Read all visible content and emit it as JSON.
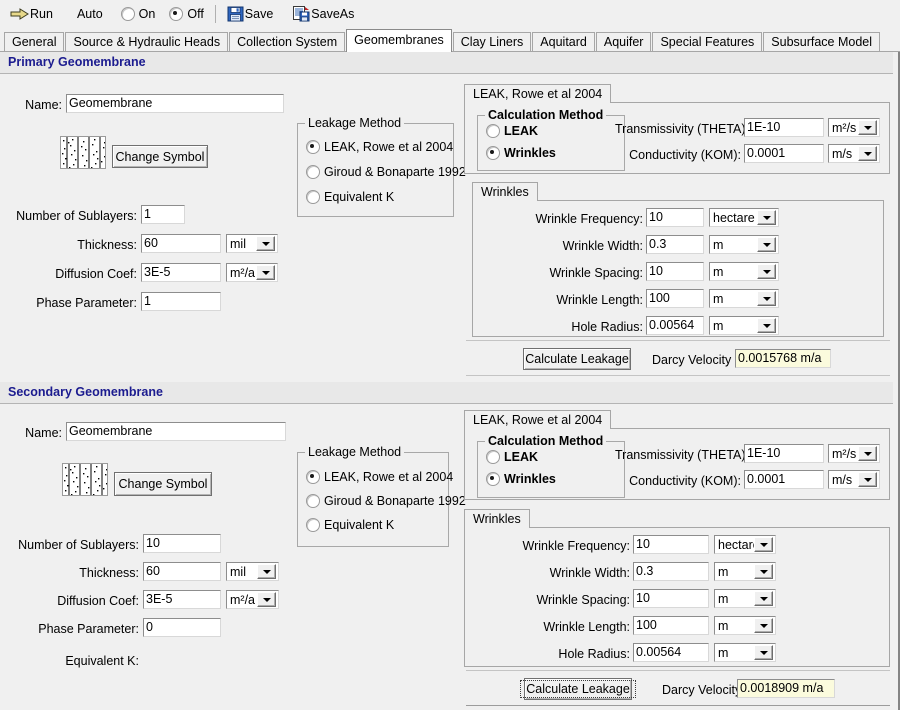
{
  "toolbar": {
    "run_label": "Run",
    "auto_label": "Auto",
    "on_label": "On",
    "off_label": "Off",
    "on_selected": false,
    "off_selected": true,
    "save_label": "Save",
    "saveas_label": "SaveAs",
    "icons": {
      "run": "run-arrow-icon",
      "save": "floppy-disk-icon",
      "saveas": "save-as-document-icon"
    }
  },
  "tabs": [
    {
      "label": "General",
      "selected": false
    },
    {
      "label": "Source & Hydraulic Heads",
      "selected": false
    },
    {
      "label": "Collection System",
      "selected": false
    },
    {
      "label": "Geomembranes",
      "selected": true
    },
    {
      "label": "Clay Liners",
      "selected": false
    },
    {
      "label": "Aquitard",
      "selected": false
    },
    {
      "label": "Aquifer",
      "selected": false
    },
    {
      "label": "Special Features",
      "selected": false
    },
    {
      "label": "Subsurface Model",
      "selected": false
    }
  ],
  "primary": {
    "heading": "Primary Geomembrane",
    "name_label": "Name:",
    "name_value": "Geomembrane",
    "change_symbol_label": "Change Symbol",
    "leakage_group_title": "Leakage Method",
    "leakage_options": [
      {
        "label": "LEAK, Rowe et al 2004",
        "selected": true
      },
      {
        "label": "Giroud & Bonaparte 1992",
        "selected": false
      },
      {
        "label": "Equivalent K",
        "selected": false
      }
    ],
    "sublayers_label": "Number of Sublayers:",
    "sublayers_value": "1",
    "thickness_label": "Thickness:",
    "thickness_value": "60",
    "thickness_unit": "mil",
    "diffusion_label": "Diffusion Coef:",
    "diffusion_value": "3E-5",
    "diffusion_unit": "m²/a",
    "phase_label": "Phase Parameter:",
    "phase_value": "1",
    "panel_tab": "LEAK, Rowe et al 2004",
    "calc_group_title": "Calculation Method",
    "calc_options": [
      {
        "label": "LEAK",
        "selected": false
      },
      {
        "label": "Wrinkles",
        "selected": true
      }
    ],
    "transmissivity_label": "Transmissivity (THETA):",
    "transmissivity_value": "1E-10",
    "transmissivity_unit": "m²/s",
    "conductivity_label": "Conductivity (KOM):",
    "conductivity_value": "0.0001",
    "conductivity_unit": "m/s",
    "wrinkles_tab": "Wrinkles",
    "wrinkle_rows": [
      {
        "label": "Wrinkle Frequency:",
        "value": "10",
        "unit": "hectare"
      },
      {
        "label": "Wrinkle Width:",
        "value": "0.3",
        "unit": "m"
      },
      {
        "label": "Wrinkle Spacing:",
        "value": "10",
        "unit": "m"
      },
      {
        "label": "Wrinkle Length:",
        "value": "100",
        "unit": "m"
      },
      {
        "label": "Hole Radius:",
        "value": "0.00564",
        "unit": "m"
      }
    ],
    "calculate_label": "Calculate Leakage",
    "darcy_label": "Darcy Velocity",
    "darcy_value": "0.0015768 m/a",
    "calculate_focused": false
  },
  "secondary": {
    "heading": "Secondary Geomembrane",
    "name_label": "Name:",
    "name_value": "Geomembrane",
    "change_symbol_label": "Change Symbol",
    "leakage_group_title": "Leakage Method",
    "leakage_options": [
      {
        "label": "LEAK, Rowe et al 2004",
        "selected": true
      },
      {
        "label": "Giroud & Bonaparte 1992",
        "selected": false
      },
      {
        "label": "Equivalent K",
        "selected": false
      }
    ],
    "sublayers_label": "Number of Sublayers:",
    "sublayers_value": "10",
    "thickness_label": "Thickness:",
    "thickness_value": "60",
    "thickness_unit": "mil",
    "diffusion_label": "Diffusion Coef:",
    "diffusion_value": "3E-5",
    "diffusion_unit": "m²/a",
    "phase_label": "Phase Parameter:",
    "phase_value": "0",
    "equivalent_k_label": "Equivalent K:",
    "panel_tab": "LEAK, Rowe et al 2004",
    "calc_group_title": "Calculation Method",
    "calc_options": [
      {
        "label": "LEAK",
        "selected": false
      },
      {
        "label": "Wrinkles",
        "selected": true
      }
    ],
    "transmissivity_label": "Transmissivity (THETA):",
    "transmissivity_value": "1E-10",
    "transmissivity_unit": "m²/s",
    "conductivity_label": "Conductivity (KOM):",
    "conductivity_value": "0.0001",
    "conductivity_unit": "m/s",
    "wrinkles_tab": "Wrinkles",
    "wrinkle_rows": [
      {
        "label": "Wrinkle Frequency:",
        "value": "10",
        "unit": "hectare"
      },
      {
        "label": "Wrinkle Width:",
        "value": "0.3",
        "unit": "m"
      },
      {
        "label": "Wrinkle Spacing:",
        "value": "10",
        "unit": "m"
      },
      {
        "label": "Wrinkle Length:",
        "value": "100",
        "unit": "m"
      },
      {
        "label": "Hole Radius:",
        "value": "0.00564",
        "unit": "m"
      }
    ],
    "calculate_label": "Calculate Leakage",
    "darcy_label": "Darcy Velocity",
    "darcy_value": "0.0018909 m/a",
    "calculate_focused": true
  },
  "colors": {
    "heading": "#1b1b8f",
    "face": "#f0f0f0",
    "readonly_field": "#fbfbdd"
  }
}
